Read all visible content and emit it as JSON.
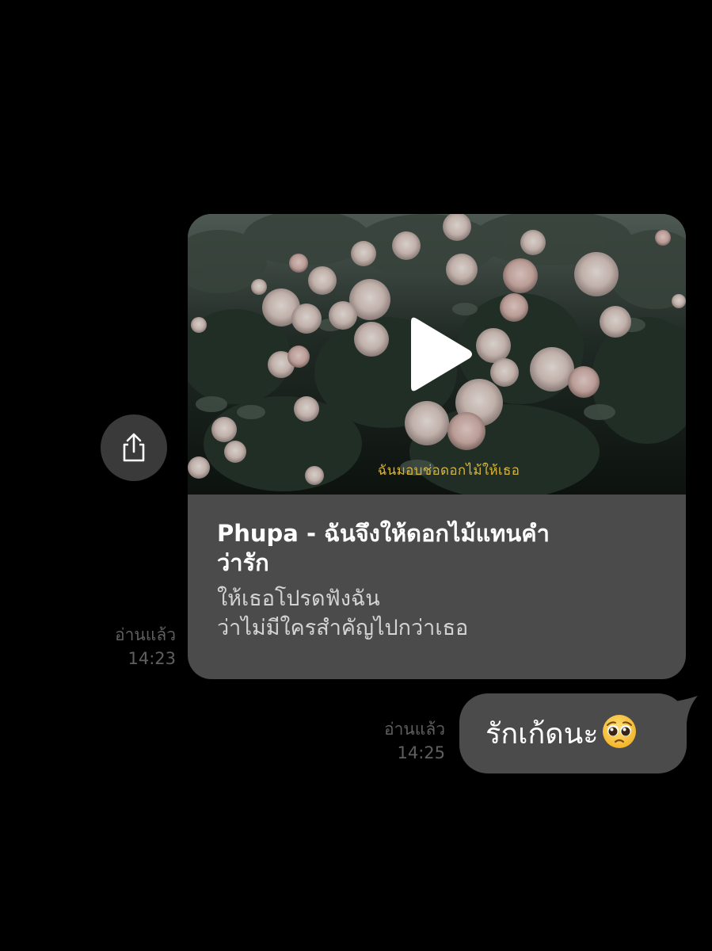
{
  "chat": {
    "messages": [
      {
        "type": "link_preview",
        "thumbnail_caption": "ฉันมอบช่อดอกไม้ให้เธอ",
        "title": "Phupa - ฉันจึงให้ดอกไม้แทนคำว่ารัก",
        "title_line1": "Phupa - ฉันจึงให้ดอกไม้แทนคำ",
        "title_line2": "ว่ารัก",
        "description_line1": "ให้เธอโปรดฟังฉัน",
        "description_line2": "ว่าไม่มีใครสำคัญไปกว่าเธอ",
        "read_label": "อ่านแล้ว",
        "time": "14:23",
        "icons": {
          "play": "play-icon",
          "share": "share-icon"
        }
      },
      {
        "type": "text",
        "text": "รักเก้ดนะ",
        "emoji": "pleading-face",
        "read_label": "อ่านแล้ว",
        "time": "14:25"
      }
    ]
  },
  "colors": {
    "background": "#000000",
    "bubble": "#4b4b4b",
    "share_button": "#3a3a3a",
    "status_text": "#5f5f5f",
    "caption": "#d6b43b"
  }
}
